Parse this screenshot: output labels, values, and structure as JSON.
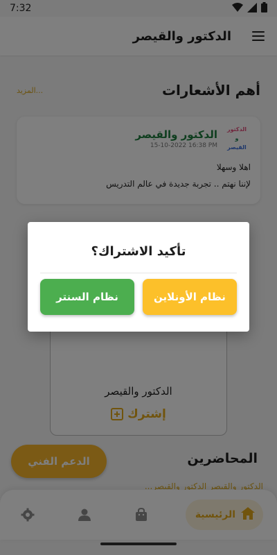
{
  "status_bar": {
    "time": "7:32",
    "icons": [
      "wifi-icon",
      "signal-icon",
      "battery-icon"
    ]
  },
  "app_bar": {
    "title": "الدكتور والقيصر",
    "menu_icon": "menu-icon"
  },
  "notifications": {
    "heading": "أهم الأشعارات",
    "more_label": "المزيد...",
    "card": {
      "logo_lines": [
        "الدكتور",
        "و",
        "القيصر"
      ],
      "name": "الدكتور والقيصر",
      "date": "15-10-2022 16:38 PM",
      "line1": "اهلا وسهلا",
      "line2": "لإننا نهتم .. تجربة جديدة في عالم التدريس"
    }
  },
  "course_card": {
    "name": "الدكتور والقيصر",
    "subscribe_label": "إشترك"
  },
  "lecturers": {
    "heading": "المحاضرين",
    "partial_text": "...الدكتور والقيصر الدكتور والقيصر"
  },
  "support_button": {
    "label": "الدعم الفني"
  },
  "bottom_nav": {
    "home_label": "الرئيسية",
    "items": [
      "home-icon",
      "bag-icon",
      "person-icon",
      "gear-icon"
    ]
  },
  "dialog": {
    "title": "تأكيد الاشتراك؟",
    "center_button": "نظام السنتر",
    "online_button": "نظام الأونلاين"
  },
  "colors": {
    "accent": "#f6b52b",
    "green": "#4cae4f",
    "yellow": "#fcc02a",
    "dark_green_text": "#1e7c3e"
  }
}
